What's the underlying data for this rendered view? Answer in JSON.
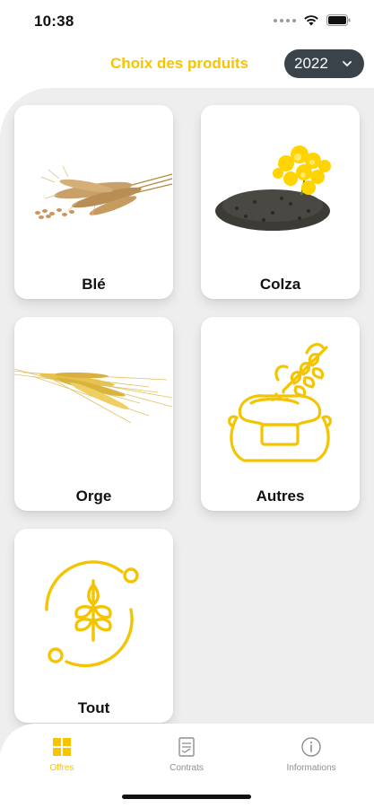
{
  "status_bar": {
    "time": "10:38"
  },
  "header": {
    "title": "Choix des produits",
    "year": "2022"
  },
  "products": [
    {
      "label": "Blé",
      "icon": "wheat-ears-photo"
    },
    {
      "label": "Colza",
      "icon": "rapeseed-photo"
    },
    {
      "label": "Orge",
      "icon": "barley-photo"
    },
    {
      "label": "Autres",
      "icon": "grain-sack-icon"
    },
    {
      "label": "Tout",
      "icon": "wheat-circle-icon"
    }
  ],
  "tabbar": {
    "tabs": [
      {
        "label": "Offres",
        "icon": "grid-icon",
        "active": true
      },
      {
        "label": "Contrats",
        "icon": "document-icon",
        "active": false
      },
      {
        "label": "Informations",
        "icon": "info-icon",
        "active": false
      }
    ]
  },
  "colors": {
    "accent": "#f6c400",
    "select_bg": "#3a434a",
    "panel_bg": "#eeeeee",
    "inactive": "#8e8e8e"
  }
}
